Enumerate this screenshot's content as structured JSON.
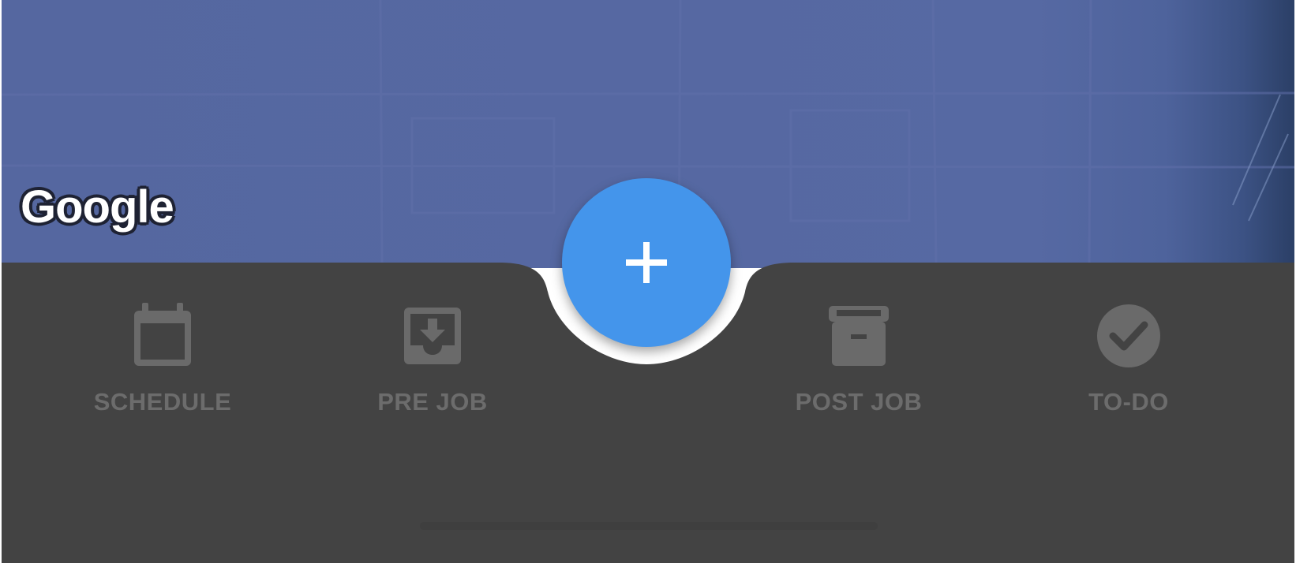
{
  "map": {
    "logo_text": "Google",
    "background_color": "#5567a0"
  },
  "bottom_nav": {
    "background_color": "#434343",
    "label_color": "#6c6c6c",
    "items": [
      {
        "label": "SCHEDULE",
        "icon": "calendar-icon"
      },
      {
        "label": "PRE JOB",
        "icon": "inbox-download-icon"
      },
      {
        "label": "POST JOB",
        "icon": "archive-box-icon"
      },
      {
        "label": "TO-DO",
        "icon": "check-circle-icon"
      }
    ]
  },
  "fab": {
    "icon": "plus-icon",
    "color": "#4495eb"
  }
}
